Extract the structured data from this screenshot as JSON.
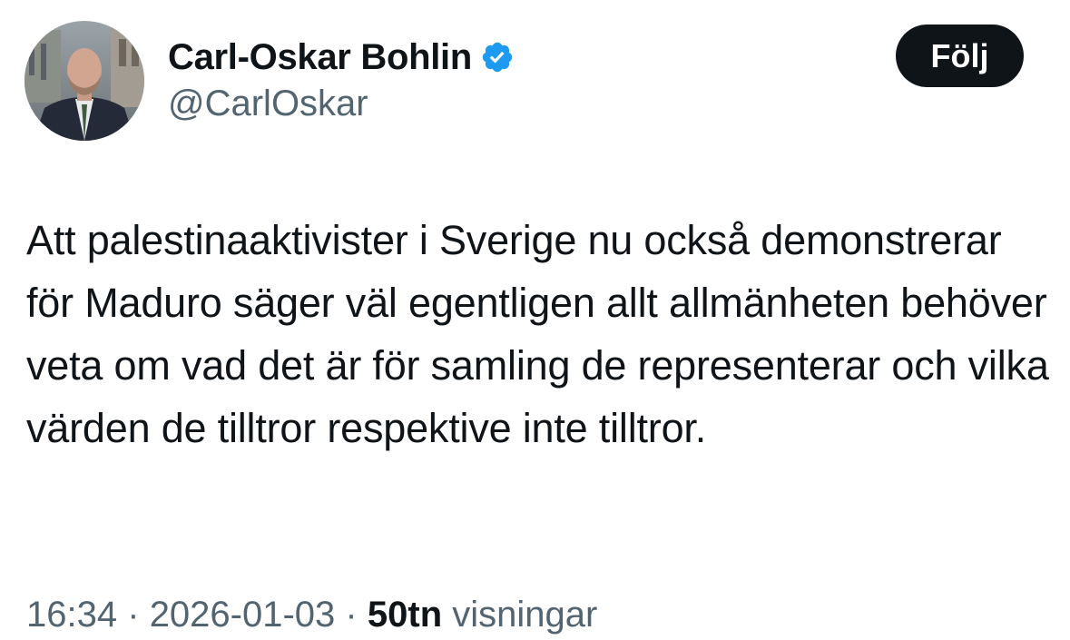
{
  "author": {
    "display_name": "Carl-Oskar Bohlin",
    "handle": "@CarlOskar",
    "verified": true,
    "verified_color": "#1d9bf0"
  },
  "follow_button": {
    "label": "Följ"
  },
  "tweet": {
    "text": "Att palestinaaktivister i Sverige nu också demonstrerar för Maduro säger väl egentligen allt allmänheten behöver veta om vad det är för samling de representerar och vilka värden de tilltror respektive inte tilltror."
  },
  "meta": {
    "time": "16:34",
    "separator": "·",
    "date": "2026-01-03",
    "views_count": "50tn",
    "views_label": "visningar"
  },
  "icons": {
    "verified": "verified-badge-icon",
    "avatar": "profile-photo"
  }
}
